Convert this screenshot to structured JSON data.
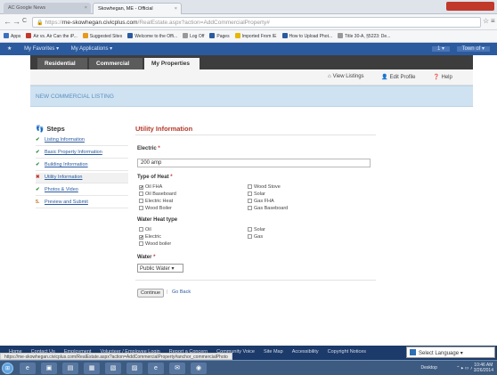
{
  "browser": {
    "tabs": [
      {
        "label": "AC Google News"
      },
      {
        "label": "Skowhegan, ME - Official"
      }
    ],
    "window_buttons": "",
    "nav": {
      "back": "←",
      "forward": "→",
      "reload": "C",
      "star": "☆",
      "menu": "≡"
    },
    "url": {
      "secure": "https://",
      "host": "me-skowhegan.civicplus.com",
      "path": "/RealEstate.aspx?action=AddCommercialProperty#"
    },
    "bookmarks": [
      {
        "label": "Apps",
        "color": "#3b6fc0"
      },
      {
        "label": "Air vs. Air Can the iP...",
        "color": "#c0392b"
      },
      {
        "label": "Suggested Sites",
        "color": "#e69a1f"
      },
      {
        "label": "Welcome to the Offi...",
        "color": "#2a5aa0"
      },
      {
        "label": "Log Off",
        "color": "#999999"
      },
      {
        "label": "Pages",
        "color": "#2a5aa0"
      },
      {
        "label": "Imported From IE",
        "color": "#e6b800"
      },
      {
        "label": "How to Upload Phot...",
        "color": "#2a5aa0"
      },
      {
        "label": "Title 30-A, §5223: De...",
        "color": "#999999"
      }
    ]
  },
  "favbar": {
    "star": "★",
    "favorites": "My Favorites ▾",
    "applications": "My Applications ▾",
    "right_items": [
      "1 ▾",
      "Town of ▾"
    ]
  },
  "main_tabs": [
    {
      "label": "Residential"
    },
    {
      "label": "Commercial"
    },
    {
      "label": "My Properties"
    }
  ],
  "toolbar": {
    "view_listings": "View Listings",
    "edit_profile": "Edit Profile",
    "help": "Help"
  },
  "banner": {
    "title": "NEW COMMERCIAL LISTING"
  },
  "steps": {
    "heading": "Steps",
    "items": [
      {
        "label": "Listing Information",
        "mark": "✔",
        "status": "done"
      },
      {
        "label": "Basic Property Information",
        "mark": "✔",
        "status": "done"
      },
      {
        "label": "Building Information",
        "mark": "✔",
        "status": "done"
      },
      {
        "label": "Utility Information",
        "mark": "✖",
        "status": "current"
      },
      {
        "label": "Photos & Video",
        "mark": "✔",
        "status": "done"
      },
      {
        "label": "Preview and Submit",
        "mark": "5.",
        "status": "pending"
      }
    ]
  },
  "form": {
    "heading": "Utility Information",
    "electric_label": "Electric",
    "electric_value": "200 amp",
    "heat_label": "Type of Heat",
    "heat_options": [
      {
        "label": "Oil FHA",
        "checked": true
      },
      {
        "label": "Wood Stove",
        "checked": false
      },
      {
        "label": "Oil Baseboard",
        "checked": false
      },
      {
        "label": "Solar",
        "checked": false
      },
      {
        "label": "Electric Heat",
        "checked": false
      },
      {
        "label": "Gas FHA",
        "checked": false
      },
      {
        "label": "Wood Boiler",
        "checked": false
      },
      {
        "label": "Gas Baseboard",
        "checked": false
      }
    ],
    "water_heat_label": "Water Heat type",
    "water_heat_options": [
      {
        "label": "Oil",
        "checked": false
      },
      {
        "label": "Solar",
        "checked": false
      },
      {
        "label": "Electric",
        "checked": true
      },
      {
        "label": "Gas",
        "checked": false
      },
      {
        "label": "Wood boiler",
        "checked": false
      }
    ],
    "water_label": "Water",
    "water_value": "Public Water ▾",
    "continue_label": "Continue",
    "separator": "|",
    "go_back_label": "Go Back"
  },
  "footer": {
    "links": [
      "Home",
      "Contact Us",
      "Employment",
      "Volunteer / Employee Login",
      "Report a Concern",
      "Community Voice",
      "Site Map",
      "Accessibility",
      "Copyright Notices"
    ],
    "status_url": "https://me-skowhegan.civicplus.com/RealEstate.aspx?action=AddCommercialProperty#anchor_commercialPhoto",
    "language": "Select Language ▾"
  },
  "taskbar": {
    "start": "⊞",
    "apps": [
      "e",
      "▣",
      "▤",
      "▦",
      "▧",
      "▨",
      "e",
      "✉",
      "◉"
    ],
    "desktop": "Desktop",
    "tray": "⌃ ▸ ▭ ♪",
    "time": "10:46 AM",
    "date": "3/26/2014"
  },
  "colors": {
    "accent_blue": "#2c5a9e",
    "done": "#2e8b3a",
    "error": "#c0392b",
    "heading": "#b43a2a"
  }
}
